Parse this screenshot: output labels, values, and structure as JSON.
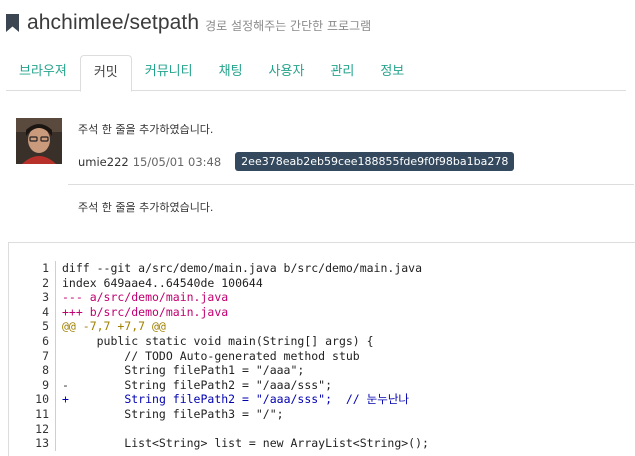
{
  "header": {
    "repo_name": "ahchimlee/setpath",
    "description": "경로 설정해주는 간단한 프로그램"
  },
  "tabs": [
    "브라우져",
    "커밋",
    "커뮤니티",
    "채팅",
    "사용자",
    "관리",
    "정보"
  ],
  "commit": {
    "message": "주석 한 줄을 추가하였습니다.",
    "author": "umie222",
    "date": "15/05/01 03:48",
    "hash": "2ee378eab2eb59cee188855fde9f0f98ba1ba278",
    "body": "주석 한 줄을 추가하였습니다."
  },
  "diff": {
    "lines": [
      {
        "n": "1",
        "m": "",
        "t": "diff --git a/src/demo/main.java b/src/demo/main.java"
      },
      {
        "n": "2",
        "m": "",
        "t": "index 649aae4..64540de 100644"
      },
      {
        "n": "3",
        "m": "",
        "t": "--- a/src/demo/main.java"
      },
      {
        "n": "4",
        "m": "",
        "t": "+++ b/src/demo/main.java"
      },
      {
        "n": "5",
        "m": "",
        "t": "@@ -7,7 +7,7 @@"
      },
      {
        "n": "6",
        "m": "",
        "t": "     public static void main(String[] args) {"
      },
      {
        "n": "7",
        "m": "",
        "t": "         // TODO Auto-generated method stub"
      },
      {
        "n": "8",
        "m": "",
        "t": "         String filePath1 = \"/aaa\";"
      },
      {
        "n": "9",
        "m": "-",
        "t": "         String filePath2 = \"/aaa/sss\";"
      },
      {
        "n": "10",
        "m": "+",
        "t": "         String filePath2 = \"/aaa/sss\";  // ",
        "korean": "눈누난나"
      },
      {
        "n": "11",
        "m": "",
        "t": "         String filePath3 = \"/\";"
      },
      {
        "n": "12",
        "m": "",
        "t": ""
      },
      {
        "n": "13",
        "m": "",
        "t": "         List<String> list = new ArrayList<String>();"
      }
    ]
  },
  "colors": {
    "accent": "#24a38c",
    "hash_bg": "#34495e",
    "diff_header": "#c00070",
    "hunk": "#a08000"
  }
}
